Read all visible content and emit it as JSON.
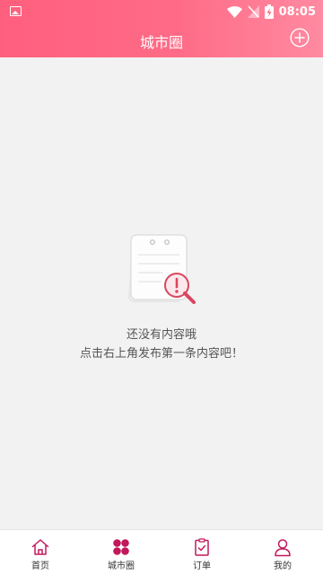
{
  "status_bar": {
    "time": "08:05",
    "icons": [
      "image-icon",
      "wifi-icon",
      "no-signal-icon",
      "battery-charging-icon"
    ]
  },
  "header": {
    "title": "城市圈",
    "action_icon": "add-circle-icon"
  },
  "empty_state": {
    "icon": "document-search-icon",
    "line1": "还没有内容哦",
    "line2": "点击右上角发布第一条内容吧！"
  },
  "tabbar": {
    "items": [
      {
        "label": "首页",
        "icon": "home-icon",
        "active": false
      },
      {
        "label": "城市圈",
        "icon": "grid-icon",
        "active": true
      },
      {
        "label": "订单",
        "icon": "clipboard-icon",
        "active": false
      },
      {
        "label": "我的",
        "icon": "user-icon",
        "active": false
      }
    ]
  },
  "colors": {
    "header": "#ff6b86",
    "accent": "#c2185b",
    "background": "#f2f2f2"
  }
}
